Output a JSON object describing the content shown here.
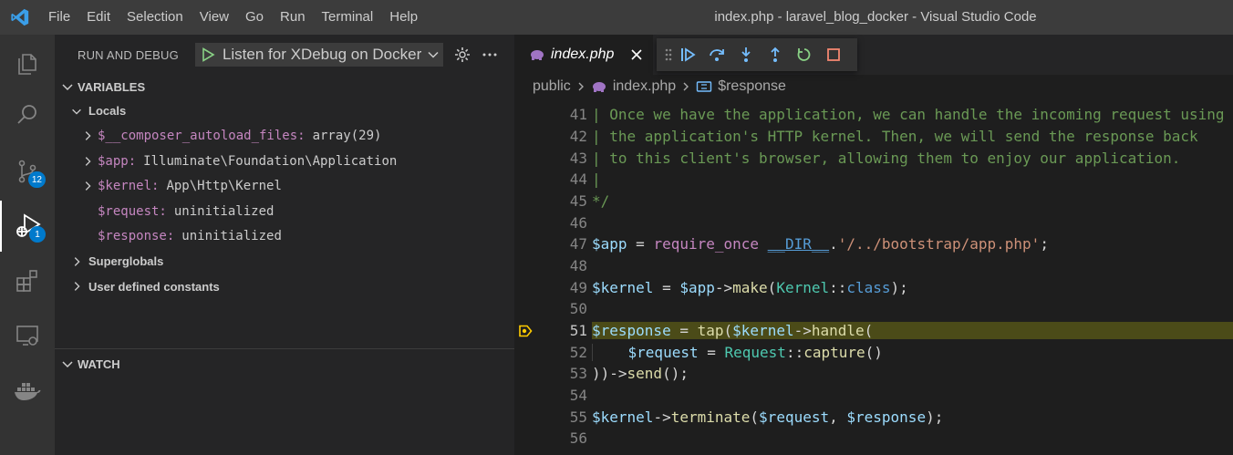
{
  "window": {
    "title": "index.php - laravel_blog_docker - Visual Studio Code",
    "menu": [
      "File",
      "Edit",
      "Selection",
      "View",
      "Go",
      "Run",
      "Terminal",
      "Help"
    ]
  },
  "activity": {
    "scm_badge": "12",
    "debug_badge": "1"
  },
  "sidebar": {
    "title": "RUN AND DEBUG",
    "launch_config": "Listen for XDebug on Docker",
    "variables_header": "VARIABLES",
    "locals_label": "Locals",
    "locals": [
      {
        "name": "$__composer_autoload_files:",
        "value": "array(29)"
      },
      {
        "name": "$app:",
        "value": "Illuminate\\Foundation\\Application"
      },
      {
        "name": "$kernel:",
        "value": "App\\Http\\Kernel"
      },
      {
        "name": "$request:",
        "value": "uninitialized"
      },
      {
        "name": "$response:",
        "value": "uninitialized"
      }
    ],
    "superglobals_label": "Superglobals",
    "constants_label": "User defined constants",
    "watch_header": "WATCH"
  },
  "editor": {
    "tab_filename": "index.php",
    "breadcrumb": [
      "public",
      "index.php",
      "$response"
    ],
    "lines": [
      {
        "n": "41",
        "text": "| Once we have the application, we can handle the incoming request using"
      },
      {
        "n": "42",
        "text": "| the application's HTTP kernel. Then, we will send the response back"
      },
      {
        "n": "43",
        "text": "| to this client's browser, allowing them to enjoy our application."
      },
      {
        "n": "44",
        "text": "|"
      },
      {
        "n": "45",
        "text": "*/"
      },
      {
        "n": "46",
        "text": ""
      },
      {
        "n": "47",
        "p": [
          "$app",
          " = ",
          "require_once",
          " ",
          "__DIR__",
          ".",
          "'/../bootstrap/app.php'",
          ";"
        ]
      },
      {
        "n": "48",
        "text": ""
      },
      {
        "n": "49",
        "p": [
          "$kernel",
          " = ",
          "$app",
          "->",
          "make",
          "(",
          "Kernel",
          "::",
          "class",
          ");"
        ]
      },
      {
        "n": "50",
        "text": ""
      },
      {
        "n": "51",
        "p": [
          "$response",
          " = ",
          "tap",
          "(",
          "$kernel",
          "->",
          "handle",
          "("
        ]
      },
      {
        "n": "52",
        "p": [
          "    ",
          "$request",
          " = ",
          "Request",
          "::",
          "capture",
          "()"
        ]
      },
      {
        "n": "53",
        "p": [
          "))->",
          "send",
          "();"
        ]
      },
      {
        "n": "54",
        "text": ""
      },
      {
        "n": "55",
        "p": [
          "$kernel",
          "->",
          "terminate",
          "(",
          "$request",
          ", ",
          "$response",
          ");"
        ]
      },
      {
        "n": "56",
        "text": ""
      }
    ]
  },
  "colors": {
    "accent": "#007acc",
    "highlight": "#4b4b18",
    "breakpoint": "#ffcc00"
  }
}
